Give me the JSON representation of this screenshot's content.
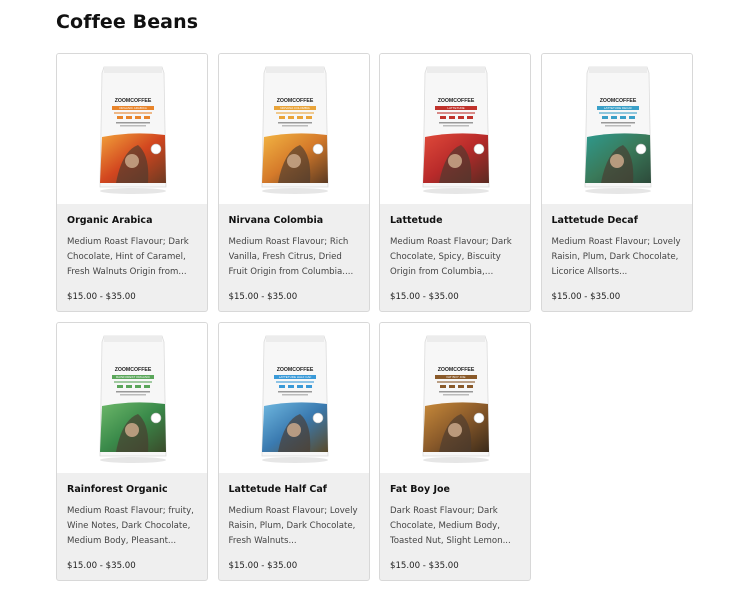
{
  "page": {
    "title": "Coffee Beans"
  },
  "brand": "ZOOMCOFFEE",
  "products": [
    {
      "name": "Organic Arabica",
      "desc": "Medium Roast Flavour; Dark Chocolate, Hint of Caramel, Fresh Walnuts Origin from...",
      "price": "$15.00 - $35.00",
      "label_color": "#e8842a",
      "art": [
        "#f2a23a",
        "#d2461f",
        "#6d3a22"
      ],
      "band": "ORGANIC ARABICA"
    },
    {
      "name": "Nirvana Colombia",
      "desc": "Medium Roast Flavour; Rich Vanilla, Fresh Citrus, Dried Fruit Origin from Columbia....",
      "price": "$15.00 - $35.00",
      "label_color": "#e9a43a",
      "art": [
        "#f3b543",
        "#d57a2a",
        "#5b3a22"
      ],
      "band": "NIRVANA COLOMBIA"
    },
    {
      "name": "Lattetude",
      "desc": "Medium Roast Flavour; Dark Chocolate, Spicy, Biscuity Origin from Columbia, Costa...",
      "price": "$15.00 - $35.00",
      "label_color": "#c0322b",
      "art": [
        "#e04a3a",
        "#b82a2a",
        "#5a2a22"
      ],
      "band": "LATTETUDE"
    },
    {
      "name": "Lattetude Decaf",
      "desc": "Medium Roast  Flavour; Lovely Raisin, Plum, Dark Chocolate, Licorice Allsorts...",
      "price": "$15.00 - $35.00",
      "label_color": "#3aa0c8",
      "art": [
        "#2e9a8e",
        "#3a7a5a",
        "#2d4a3a"
      ],
      "band": "LATTETUDE DECAF"
    },
    {
      "name": "Rainforest Organic",
      "desc": "Medium Roast Flavour; fruity, Wine Notes, Dark Chocolate, Medium Body, Pleasant...",
      "price": "$15.00 - $35.00",
      "label_color": "#5aa65a",
      "art": [
        "#6db86a",
        "#3a8a4a",
        "#3a4a2a"
      ],
      "band": "RAINFOREST ORGANIC"
    },
    {
      "name": "Lattetude Half Caf",
      "desc": "Medium Roast  Flavour; Lovely Raisin, Plum, Dark Chocolate, Fresh Walnuts...",
      "price": "$15.00 - $35.00",
      "label_color": "#3a9ad8",
      "art": [
        "#6fb8e0",
        "#3a7ab0",
        "#5a4a2a"
      ],
      "band": "LATTETUDE HALF CAF"
    },
    {
      "name": "Fat Boy Joe",
      "desc": "Dark Roast Flavour; Dark Chocolate, Medium Body, Toasted Nut, Slight Lemon...",
      "price": "$15.00 - $35.00",
      "label_color": "#8a5a2a",
      "art": [
        "#c88a3a",
        "#8a5a2a",
        "#3a2a1a"
      ],
      "band": "FAT BOY JOE"
    }
  ]
}
